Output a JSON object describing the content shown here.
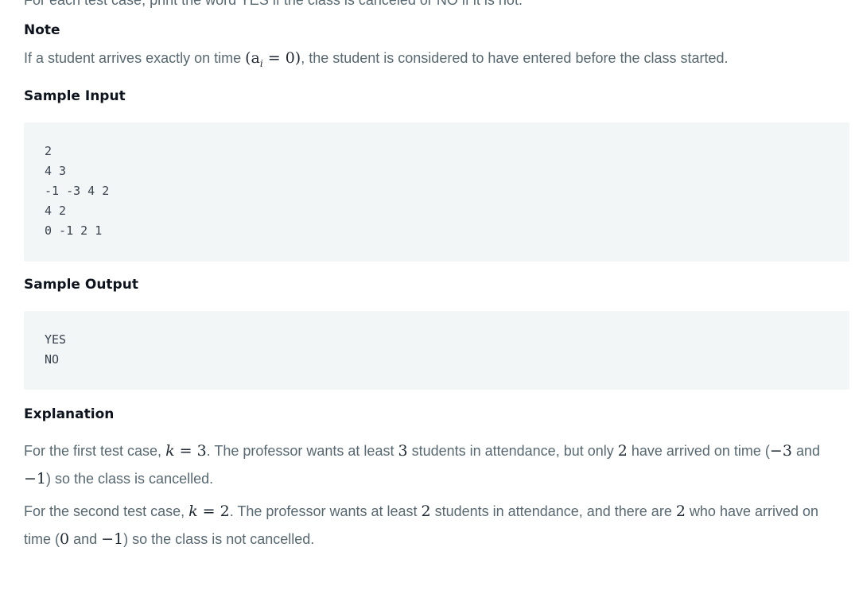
{
  "top_cut_text": "For each test case, print the word YES if the class is canceled or NO if it is not.",
  "note": {
    "heading": "Note",
    "text_before": "If a student arrives exactly on time ",
    "math": "(a",
    "math_sub": "i",
    "math_rest": " = 0)",
    "text_after": ", the student is considered to have entered before the class started."
  },
  "sample_input": {
    "heading": "Sample Input",
    "lines": [
      "2",
      "4 3",
      "-1 -3 4 2",
      "4 2",
      "0 -1 2 1"
    ]
  },
  "sample_output": {
    "heading": "Sample Output",
    "lines": [
      "YES",
      "NO"
    ]
  },
  "explanation": {
    "heading": "Explanation",
    "para1": {
      "t1": "For the first test case, ",
      "m1": "k = 3",
      "t2": ". The professor wants at least ",
      "m2": "3",
      "t3": " students in attendance, but only ",
      "m3": "2",
      "t4": " have arrived on time (",
      "m4": "−3",
      "t5": " and",
      "m5": "−1",
      "t6": ") so the class is cancelled."
    },
    "para2": {
      "t1": "For the second test case, ",
      "m1": "k = 2",
      "t2": ". The professor wants at least ",
      "m2": "2",
      "t3": " students in attendance, and there are ",
      "m3": "2",
      "t4": " who have arrived on",
      "t5": "time (",
      "m4": "0",
      "t6": " and ",
      "m5": "−1",
      "t7": ") so the class is not cancelled."
    }
  }
}
